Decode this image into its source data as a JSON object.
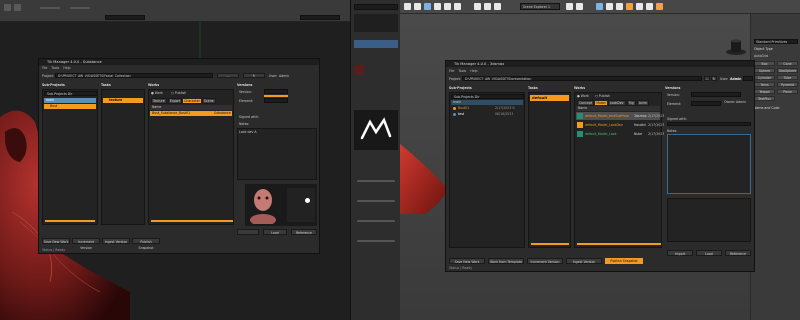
{
  "left": {
    "tik": {
      "title": "Tik Manager 4.0.0 - Substance",
      "menu": [
        "File",
        "Tools",
        "Help"
      ],
      "project_label": "Project:",
      "project_path": "D:\\PROJECT_AW_VIS\\ASSETS\\Facial_Collection",
      "user_label": "User:",
      "user_value": "Admin",
      "sub_projects": {
        "header": "Sub-Projects",
        "filter": "Sub-Projects Dir",
        "items": [
          {
            "name": "main",
            "color": "#5d8fb3"
          },
          {
            "name": "Bust",
            "color": "#f39a1f"
          }
        ]
      },
      "tasks": {
        "header": "Tasks",
        "items": [
          {
            "name": "texture",
            "color": "#f39a1f"
          }
        ]
      },
      "works": {
        "header": "Works",
        "radio": [
          "Work",
          "Publish"
        ],
        "tabs": [
          "Texture",
          "Export",
          "Character",
          "Scene"
        ],
        "column": "Name",
        "rows": [
          {
            "name": "Bust_Substance_Bust01",
            "tag": "Substance"
          }
        ]
      },
      "versions": {
        "header": "Versions",
        "version_label": "Version:",
        "element_label": "Element:",
        "signed_label": "Signed with:",
        "notes_label": "Notes:",
        "notes_value": "Look dev A"
      },
      "buttons": {
        "new_work": "Save New Work",
        "increment": "Increment Version",
        "ingest": "Ingest Version",
        "publish": "Publish Snapshot",
        "load": "Load",
        "reference": "Reference"
      },
      "status": "Status | Ready"
    }
  },
  "right": {
    "top_label": "Scene Explorer 1",
    "cmd_panel": {
      "title": "Standard Primitives",
      "section": "Object Type",
      "items": [
        "AutoGrid",
        "Box",
        "Cone",
        "Sphere",
        "GeoSphere",
        "Cylinder",
        "Tube",
        "Torus",
        "Pyramid",
        "Teapot",
        "Plane",
        "TextPlus"
      ],
      "name_color": "Name and Color"
    },
    "tik": {
      "title": "Tik Manager 4.0.0 - 3dsmax",
      "menu": [
        "File",
        "Tools",
        "Help"
      ],
      "project_label": "Project:",
      "project_path": "D:\\PROJECT_AW_VIS\\ASSETS\\presentation",
      "user_label": "User:",
      "user_value": "Admin",
      "sub_projects": {
        "header": "Sub-Projects",
        "filter": "Sub-Projects Dir",
        "items": [
          {
            "name": "Bust01",
            "date": "2/17/2023 0:",
            "color": "#f39a1f"
          },
          {
            "name": "test",
            "date": "08/16/2023",
            "color": "#5d8fb3"
          }
        ]
      },
      "tasks": {
        "header": "Tasks",
        "items": [
          {
            "name": "default",
            "color": "#f39a1f"
          }
        ]
      },
      "works": {
        "header": "Works",
        "radio": [
          "Work",
          "Publish"
        ],
        "tabs": [
          "Concept",
          "Model",
          "LookDev",
          "Rig",
          "Anim"
        ],
        "column": "Name",
        "rows": [
          {
            "name": "default_Model_testSubProjects",
            "dcc": "3dsmax",
            "date": "2/17/2023",
            "highlight": true
          },
          {
            "name": "default_Model_LookDev",
            "dcc": "Houdini",
            "date": "2/17/2023",
            "highlight": false
          },
          {
            "name": "default_Model_Look",
            "dcc": "Nuke",
            "date": "2/17/2023",
            "highlight": false
          }
        ]
      },
      "versions": {
        "header": "Versions",
        "version_label": "Version:",
        "element_label": "Element:",
        "owner_label": "Owner:",
        "owner_value": "Admin",
        "signed_label": "Signed with:",
        "notes_label": "Notes:"
      },
      "buttons": {
        "new_work": "Save New Work",
        "work_from_template": "Work from Template",
        "increment": "Increment Version",
        "ingest": "Ingest Version",
        "publish": "Publish Snapshot",
        "import": "Import",
        "load": "Load",
        "reference": "Reference"
      },
      "status": "Status | Ready"
    }
  }
}
